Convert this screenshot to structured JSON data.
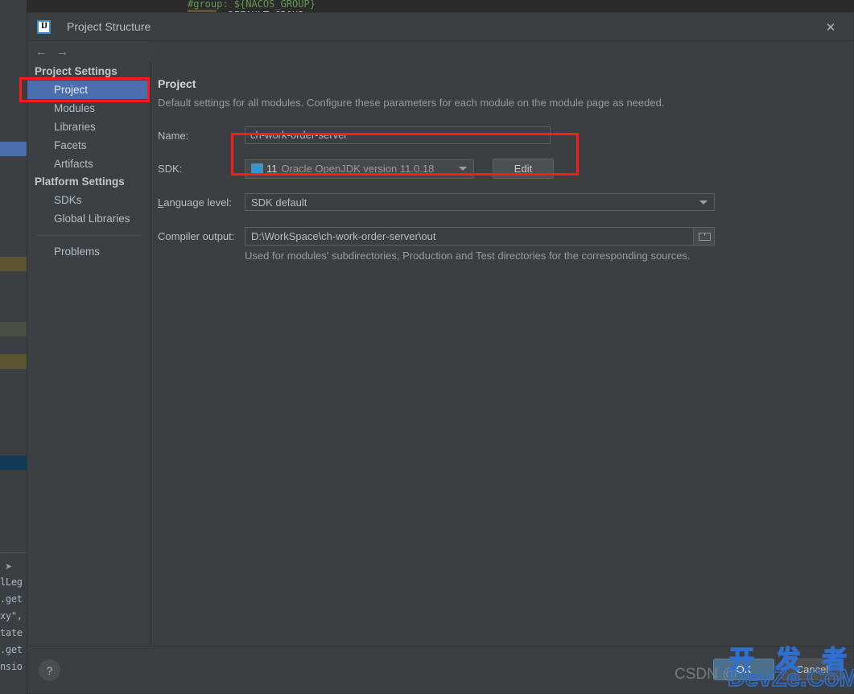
{
  "ide": {
    "code_top_comment": "#group: ${NACOS_GROUP}",
    "code_top_key": "group",
    "code_top_value": ": DEFAULT_GROUP",
    "edge_code": [
      "lLeg",
      ".get",
      "xy\",",
      "tate",
      ".get",
      "nsio"
    ],
    "edge_icon": "cursor-icon"
  },
  "dialog": {
    "title": "Project Structure",
    "app_icon_label": "IJ",
    "close_icon": "close-icon",
    "nav": {
      "back_icon": "arrow-left-icon",
      "forward_icon": "arrow-right-icon"
    }
  },
  "sidebar": {
    "groups": [
      {
        "label": "Project Settings",
        "items": [
          {
            "label": "Project",
            "selected": true
          },
          {
            "label": "Modules",
            "selected": false
          },
          {
            "label": "Libraries",
            "selected": false
          },
          {
            "label": "Facets",
            "selected": false
          },
          {
            "label": "Artifacts",
            "selected": false
          }
        ]
      },
      {
        "label": "Platform Settings",
        "items": [
          {
            "label": "SDKs",
            "selected": false
          },
          {
            "label": "Global Libraries",
            "selected": false
          }
        ]
      }
    ],
    "problems_label": "Problems"
  },
  "main": {
    "title": "Project",
    "subtitle": "Default settings for all modules. Configure these parameters for each module on the module page as needed.",
    "name": {
      "label": "Name:",
      "value": "ch-work-order-server"
    },
    "sdk": {
      "label": "SDK:",
      "icon": "jdk-icon",
      "version": "11",
      "name": "Oracle OpenJDK version 11.0.18",
      "dropdown_icon": "chevron-down-icon",
      "edit_button": {
        "mnemonic": "E",
        "rest": "dit"
      }
    },
    "language_level": {
      "label_mnemonic": "L",
      "label_rest": "anguage level:",
      "value": "SDK default",
      "dropdown_icon": "chevron-down-icon"
    },
    "compiler_output": {
      "label": "Compiler output:",
      "value": "D:\\WorkSpace\\ch-work-order-server\\out",
      "browse_icon": "folder-icon",
      "hint": "Used for modules' subdirectories, Production and Test directories for the corresponding sources."
    }
  },
  "footer": {
    "help_icon": "help-icon",
    "ok_label": "OK",
    "cancel_label": "Cancel"
  },
  "watermarks": {
    "csdn": "CSDN @",
    "chinese": "开 发 者",
    "site": "DevZe.CoM"
  },
  "colors": {
    "accent_selected": "#4b6eaf",
    "primary_button": "#4a708b",
    "annotation": "#ff1a1a",
    "dialog_bg": "#3c3f41",
    "sidebar_bg": "#3c4043",
    "watermark_blue": "#2f6fd0"
  }
}
